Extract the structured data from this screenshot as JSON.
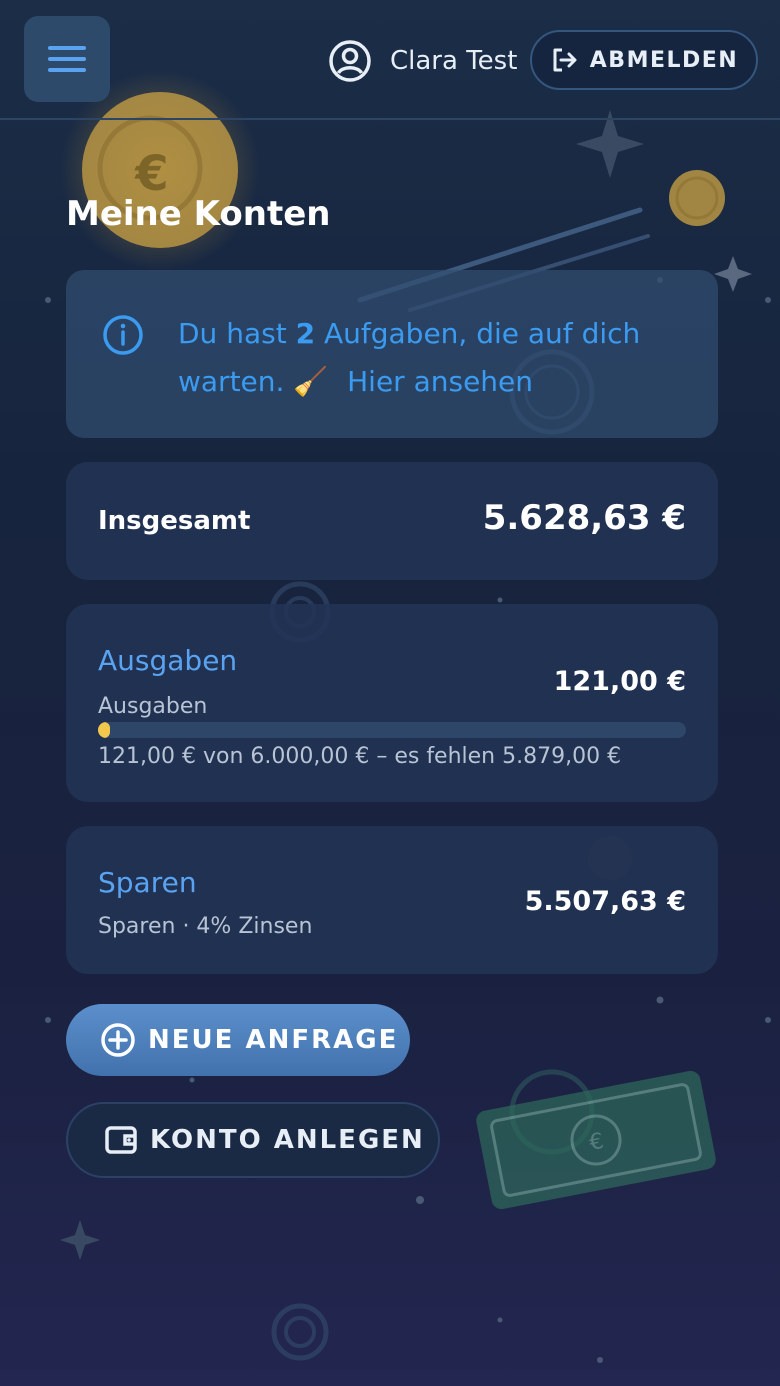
{
  "header": {
    "menu_icon": "hamburger-menu-icon",
    "user_icon": "user-circle-icon",
    "user_name": "Clara Test",
    "logout_icon": "logout-icon",
    "logout_label": "ABMELDEN"
  },
  "page_title": "Meine Konten",
  "info_banner": {
    "icon": "info-icon",
    "prefix": "Du hast",
    "count": "2",
    "suffix": "Aufgaben, die auf dich warten.",
    "emoji": "🧹",
    "link_label": "Hier ansehen"
  },
  "total": {
    "label": "Insgesamt",
    "value": "5.628,63 €"
  },
  "accounts": [
    {
      "name": "Ausgaben",
      "subtitle": "Ausgaben",
      "balance": "121,00 €",
      "goal_progress": 0.0202,
      "goal_text": "121,00 € von 6.000,00 € – es fehlen 5.879,00 €"
    },
    {
      "name": "Sparen",
      "subtitle": "Sparen · 4% Zinsen",
      "balance": "5.507,63 €"
    }
  ],
  "actions": {
    "new_request_icon": "plus-circle-icon",
    "new_request_label": "NEUE ANFRAGE",
    "create_account_icon": "wallet-icon",
    "create_account_label": "KONTO ANLEGEN"
  },
  "colors": {
    "accent": "#5aa3f0",
    "info_text": "#3b9bf0",
    "progress": "#f2c94c",
    "primary_button": "#4f82bd"
  }
}
